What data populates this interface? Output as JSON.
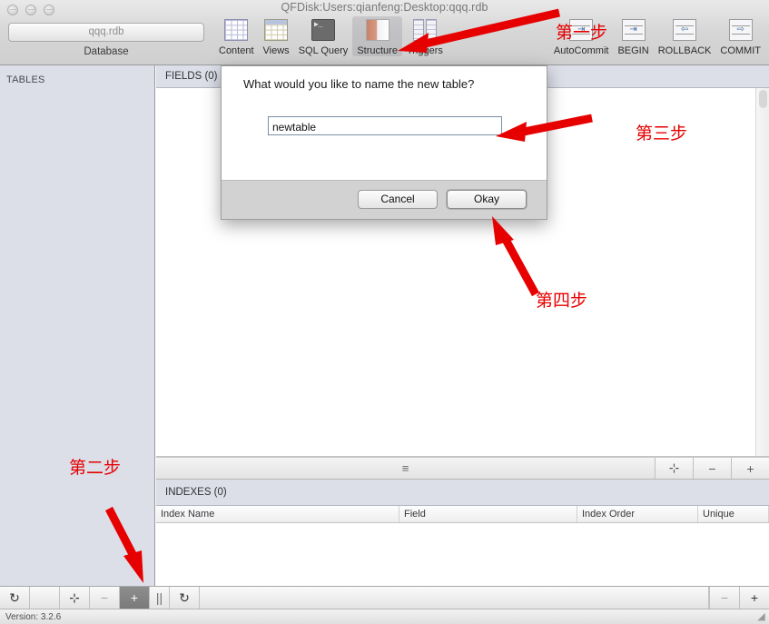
{
  "window": {
    "title": "QFDisk:Users:qianfeng:Desktop:qqq.rdb",
    "traffic_lights": [
      "close",
      "minimize",
      "zoom"
    ]
  },
  "toolbar": {
    "database_button_value": "qqq.rdb",
    "database_label": "Database",
    "items": [
      {
        "label": "Content",
        "icon": "grid-icon",
        "selected": false
      },
      {
        "label": "Views",
        "icon": "views-grid-icon",
        "selected": false
      },
      {
        "label": "SQL Query",
        "icon": "terminal-icon",
        "selected": false
      },
      {
        "label": "Structure",
        "icon": "structure-icon",
        "selected": true
      },
      {
        "label": "Triggers",
        "icon": "triggers-icon",
        "selected": false
      }
    ],
    "commit_items": [
      {
        "label": "AutoCommit",
        "icon": "autocommit-icon"
      },
      {
        "label": "BEGIN",
        "icon": "begin-icon"
      },
      {
        "label": "ROLLBACK",
        "icon": "rollback-icon"
      },
      {
        "label": "COMMIT",
        "icon": "commit-icon"
      }
    ]
  },
  "sidebar": {
    "header": "TABLES",
    "tables": []
  },
  "main": {
    "fields_header": "FIELDS (0)",
    "indexes_header": "INDEXES (0)",
    "index_columns": [
      "Index Name",
      "Field",
      "Index Order",
      "Unique"
    ],
    "index_rows": [],
    "splitter_grip_icon": "hamburger-icon",
    "splitter_buttons": [
      {
        "icon": "duplicate-field-icon",
        "label": "⊹"
      },
      {
        "icon": "remove-field-icon",
        "label": "−"
      },
      {
        "icon": "add-field-icon",
        "label": "+"
      }
    ]
  },
  "bottom_toolbar": {
    "left_buttons": [
      {
        "icon": "refresh-icon",
        "label": "↻",
        "state": "normal"
      },
      {
        "icon": "duplicate-table-icon",
        "label": "⊹",
        "state": "normal"
      },
      {
        "icon": "remove-table-icon",
        "label": "−",
        "state": "disabled"
      },
      {
        "icon": "add-table-icon",
        "label": "+",
        "state": "active"
      },
      {
        "icon": "pause-icon",
        "label": "||",
        "state": "normal"
      },
      {
        "icon": "reload-icon",
        "label": "↻",
        "state": "normal"
      }
    ],
    "right_buttons": [
      {
        "icon": "remove-index-icon",
        "label": "−",
        "state": "disabled"
      },
      {
        "icon": "add-index-icon",
        "label": "+",
        "state": "normal"
      }
    ]
  },
  "statusbar": {
    "version": "Version: 3.2.6",
    "resizer_icon": "resize-grip-icon"
  },
  "dialog": {
    "prompt": "What would you like to name the new table?",
    "input_value": "newtable",
    "input_placeholder": "newtable",
    "cancel_label": "Cancel",
    "okay_label": "Okay"
  },
  "annotations": {
    "accent_color": "#e60000",
    "steps": [
      {
        "id": "step-one",
        "text": "第一步"
      },
      {
        "id": "step-two",
        "text": "第二步"
      },
      {
        "id": "step-three",
        "text": "第三步"
      },
      {
        "id": "step-four",
        "text": "第四步"
      }
    ]
  }
}
